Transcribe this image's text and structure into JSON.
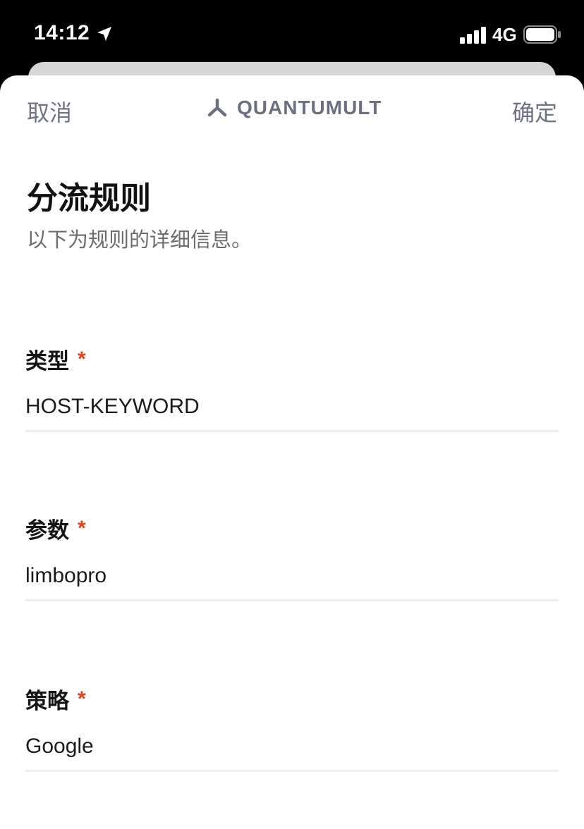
{
  "status_bar": {
    "time": "14:12",
    "network": "4G"
  },
  "nav": {
    "cancel_label": "取消",
    "brand_name": "QUANTUMULT",
    "confirm_label": "确定"
  },
  "header": {
    "title": "分流规则",
    "subtitle": "以下为规则的详细信息。"
  },
  "fields": [
    {
      "label": "类型",
      "required_mark": "*",
      "value": "HOST-KEYWORD"
    },
    {
      "label": "参数",
      "required_mark": "*",
      "value": "limbopro"
    },
    {
      "label": "策略",
      "required_mark": "*",
      "value": "Google"
    }
  ],
  "colors": {
    "accent_required": "#e2401f",
    "nav_text": "#6f7282"
  }
}
